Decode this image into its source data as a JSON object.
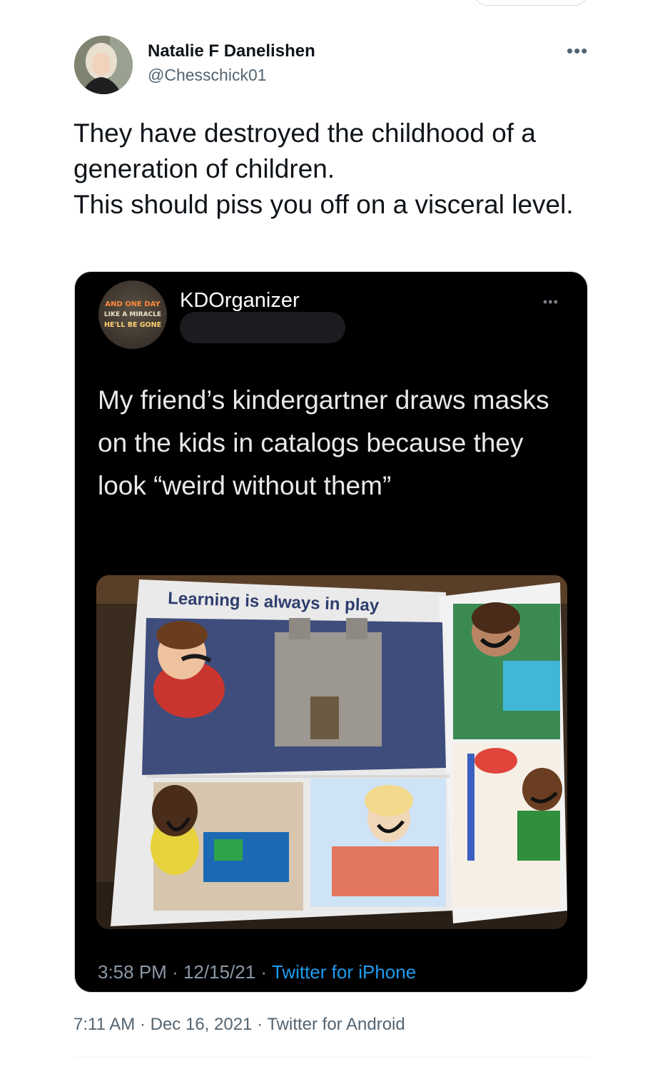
{
  "tweet": {
    "author_name": "Natalie F Danelishen",
    "author_handle": "@Chesschick01",
    "more_icon": "more-horizontal-icon",
    "text_lines": [
      "They have destroyed the childhood of a generation of children.",
      "This should piss you off on a visceral level."
    ],
    "time": "7:11 AM",
    "date": "Dec 16, 2021",
    "source": "Twitter for Android",
    "separator": "·"
  },
  "quoted": {
    "avatar_text": [
      "AND ONE DAY",
      "LIKE A MIRACLE",
      "HE'LL BE GONE"
    ],
    "author_name": "KDOrganizer",
    "text": "My friend’s kindergartner draws masks on the kids in catalogs because they look “weird without them”",
    "photo": {
      "headline": "Learning is always in play"
    },
    "time": "3:58 PM",
    "date": "12/15/21",
    "source": "Twitter for iPhone",
    "separator": "·"
  },
  "colors": {
    "primary_text": "#0f1419",
    "secondary_text": "#536471",
    "link_blue": "#1d9bf0",
    "quote_bg": "#000000"
  }
}
